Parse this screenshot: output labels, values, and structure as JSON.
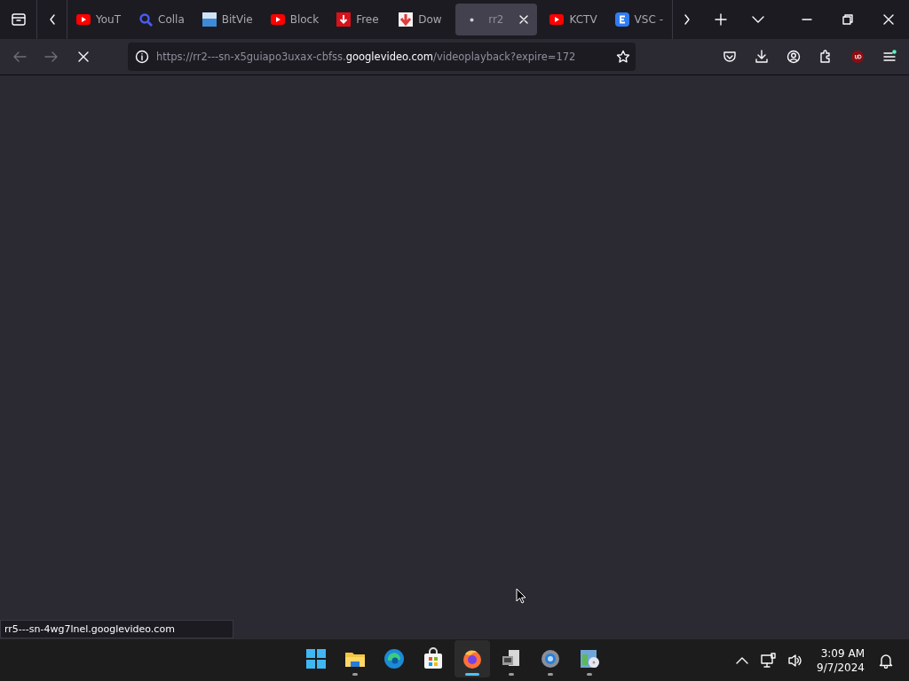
{
  "tabs": [
    {
      "label": "YouT",
      "kind": "youtube",
      "selected": false
    },
    {
      "label": "Colla",
      "kind": "search",
      "selected": false
    },
    {
      "label": "BitVie",
      "kind": "bitview",
      "selected": false
    },
    {
      "label": "Block",
      "kind": "youtube",
      "selected": false
    },
    {
      "label": "Free",
      "kind": "download",
      "selected": false
    },
    {
      "label": "Dow",
      "kind": "downloadlight",
      "selected": false
    },
    {
      "label": "rr2",
      "kind": "dot",
      "selected": true
    },
    {
      "label": "KCTV",
      "kind": "youtube",
      "selected": false
    },
    {
      "label": "VSC -",
      "kind": "appe",
      "selected": false
    }
  ],
  "address_bar": {
    "prefix": "https://rr2---sn-x5guiapo3uxax-cbfss.",
    "host": "googlevideo.com",
    "path": "/videoplayback?expire=172"
  },
  "loading": true,
  "status_link": "rr5---sn-4wg7lnel.googlevideo.com",
  "taskbar": {
    "apps": [
      {
        "kind": "start",
        "running": false,
        "selected": false
      },
      {
        "kind": "folder",
        "running": true,
        "selected": false
      },
      {
        "kind": "edge",
        "running": false,
        "selected": false
      },
      {
        "kind": "store",
        "running": false,
        "selected": false
      },
      {
        "kind": "firefox",
        "running": true,
        "selected": true
      },
      {
        "kind": "computer",
        "running": true,
        "selected": false
      },
      {
        "kind": "gear",
        "running": true,
        "selected": false
      },
      {
        "kind": "disc",
        "running": true,
        "selected": false
      }
    ],
    "time": "3:09 AM",
    "date": "9/7/2024"
  }
}
